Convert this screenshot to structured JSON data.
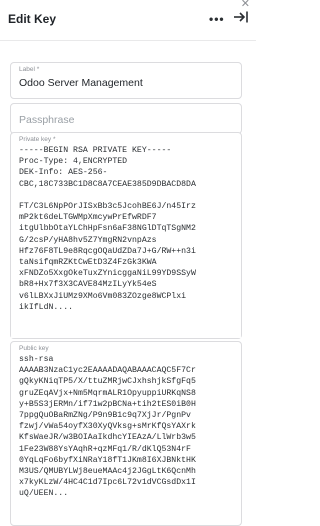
{
  "header": {
    "title": "Edit Key",
    "more_glyph": "•••",
    "close_glyph": "✕",
    "collapse_icon": "collapse-panel-icon"
  },
  "fields": {
    "label": {
      "label": "Label *",
      "value": "Odoo Server Management"
    },
    "passphrase": {
      "placeholder": "Passphrase"
    },
    "private_key": {
      "label": "Private key *",
      "value": "-----BEGIN RSA PRIVATE KEY-----\nProc-Type: 4,ENCRYPTED\nDEK-Info: AES-256-\nCBC,18C733BC1D8C8A7CEAE385D9DBACD8DA\n\nFT/C3L6NpPOrJISxBb3c5JcohBE6J/n45Irz\nmP2kt6deLTGWMpXmcywPrEfwRDF7\nitgUlbbOtaYLChHpFsn6aF38NGlDTqTSgNM2\nG/2csP/yHA8hv5Z7YmgRN2vnpAzs\nHfz76F8TL9e8RqcgOQaUdZDa7J+G/RW++n3i\ntaNsifqmRZKtCwEtD3Z4FzGk3KWA\nxFNDZo5XxgOkeTuxZYnicggaNiL99YD9SSyW\nbR8+Hx7f3X3CAVE84MzILyYk54eS\nv6lLBXxJiUMz9XMo6Vm083ZOzge8WCPlxi\nikIfLdN...."
    },
    "public_key": {
      "label": "Public key",
      "value": "ssh-rsa\nAAAAB3NzaC1yc2EAAAADAQABAAACAQC5F7Cr\ngQkyKNiqTP5/X/ttuZMRjwCJxhshjkSfgFq5\ngruZEqAVjx+Nm5MqrmALR1OpyuppiURKqNS8\ny+B5S3jERMn/if71w2pBCNa+tih2tES0iB0H\n7ppgQuOBaRmZNg/P9n9B1c9q7XjJr/PgnPv\nfzwj/vWa54oyfX30XyQVksg+sMrKfQsYAXrk\nKfsWaeJR/w3BOIAaIkdhcYIEAzA/LlWrb3w5\n1Fe23W88YsYAqhR+qzMFq1/R/dKlQ53N4rF\n0YqLqFo6byfXiNRaY18fT1JKm8I6XJBNktHK\nM3US/QMUBYLWj8eueMAAc4j2JGgLtK6QcnMh\nx7kyKLzW/4HC4C1d7Ipc6L72v1dVCGsdDx1I\nuQ/UEEN..."
    }
  }
}
